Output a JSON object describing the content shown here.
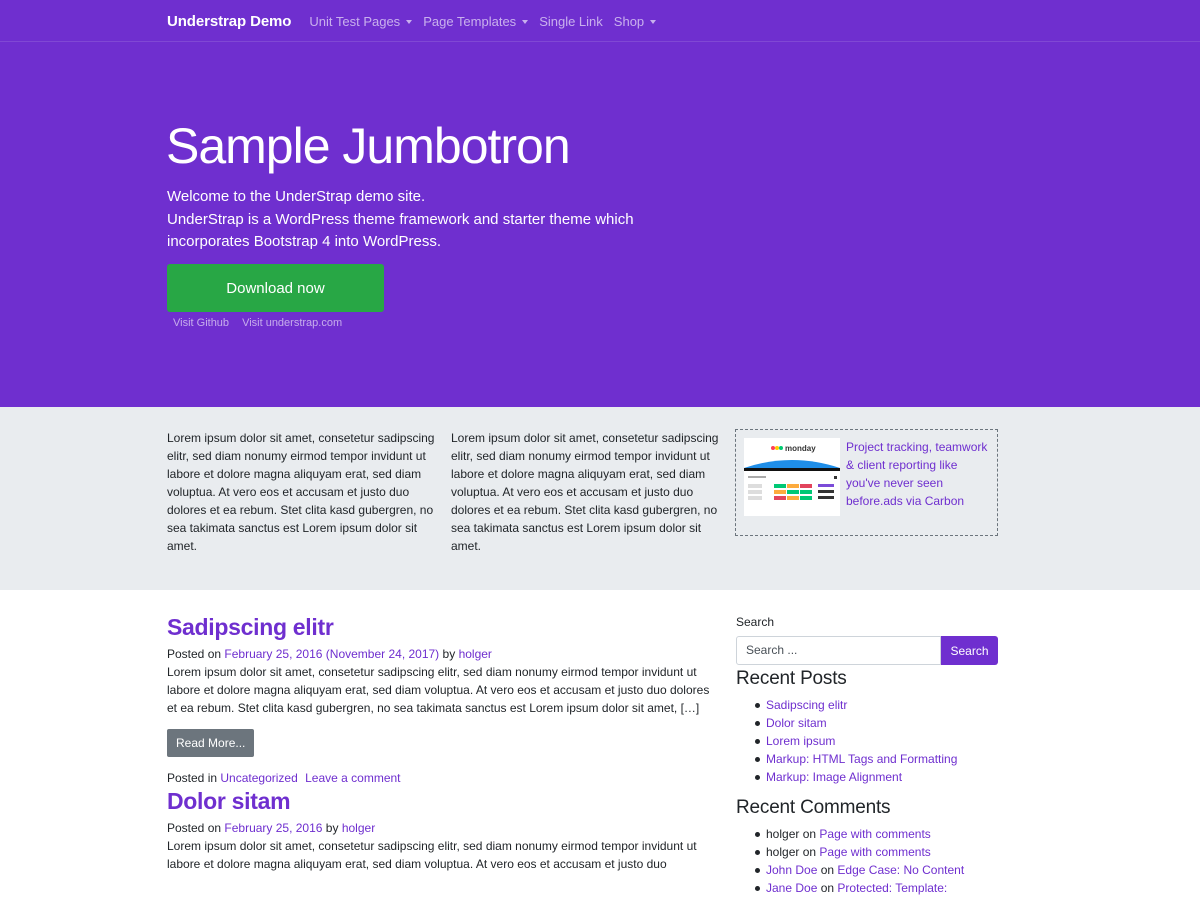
{
  "nav": {
    "brand": "Understrap Demo",
    "items": [
      {
        "label": "Unit Test Pages",
        "dropdown": true
      },
      {
        "label": "Page Templates",
        "dropdown": true
      },
      {
        "label": "Single Link",
        "dropdown": false
      },
      {
        "label": "Shop",
        "dropdown": true
      }
    ]
  },
  "hero": {
    "title": "Sample Jumbotron",
    "line1": "Welcome to the UnderStrap demo site.",
    "line2": "UnderStrap is a WordPress theme framework and starter theme which incorporates Bootstrap 4 into WordPress.",
    "button": "Download now",
    "link_github": "Visit Github",
    "link_site": "Visit understrap.com"
  },
  "band": {
    "col1": "Lorem ipsum dolor sit amet, consetetur sadipscing elitr, sed diam nonumy eirmod tempor invidunt ut labore et dolore magna aliquyam erat, sed diam voluptua. At vero eos et accusam et justo duo dolores et ea rebum. Stet clita kasd gubergren, no sea takimata sanctus est Lorem ipsum dolor sit amet.",
    "col2": "Lorem ipsum dolor sit amet, consetetur sadipscing elitr, sed diam nonumy eirmod tempor invidunt ut labore et dolore magna aliquyam erat, sed diam voluptua. At vero eos et accusam et justo duo dolores et ea rebum. Stet clita kasd gubergren, no sea takimata sanctus est Lorem ipsum dolor sit amet.",
    "ad_text": "Project tracking, teamwork & client reporting like you've never seen before.ads via Carbon",
    "ad_logo": "monday"
  },
  "posts": [
    {
      "title": "Sadipscing elitr",
      "posted_on_label": "Posted on",
      "date": "February 25, 2016 (November 24, 2017)",
      "by_label": "by",
      "author": "holger",
      "excerpt": "Lorem ipsum dolor sit amet, consetetur sadipscing elitr, sed diam nonumy eirmod tempor invidunt ut labore et dolore magna aliquyam erat, sed diam voluptua. At vero eos et accusam et justo duo dolores et ea rebum. Stet clita kasd gubergren, no sea takimata sanctus est Lorem ipsum dolor sit amet, […]",
      "read_more": "Read More...",
      "posted_in_label": "Posted in",
      "category": "Uncategorized",
      "comment_link": "Leave a comment"
    },
    {
      "title": "Dolor sitam",
      "posted_on_label": "Posted on",
      "date": "February 25, 2016",
      "by_label": "by",
      "author": "holger",
      "excerpt": "Lorem ipsum dolor sit amet, consetetur sadipscing elitr, sed diam nonumy eirmod tempor invidunt ut labore et dolore magna aliquyam erat, sed diam voluptua. At vero eos et accusam et justo duo"
    }
  ],
  "sidebar": {
    "search_label": "Search",
    "search_placeholder": "Search ...",
    "search_button": "Search",
    "recent_posts_title": "Recent Posts",
    "recent_posts": [
      "Sadipscing elitr",
      "Dolor sitam",
      "Lorem ipsum",
      "Markup: HTML Tags and Formatting",
      "Markup: Image Alignment"
    ],
    "recent_comments_title": "Recent Comments",
    "on_label": "on",
    "recent_comments": [
      {
        "author": "holger",
        "author_link": false,
        "post": "Page with comments"
      },
      {
        "author": "holger",
        "author_link": false,
        "post": "Page with comments"
      },
      {
        "author": "John Doe",
        "author_link": true,
        "post": "Edge Case: No Content"
      },
      {
        "author": "Jane Doe",
        "author_link": true,
        "post": "Protected: Template:"
      }
    ]
  },
  "colors": {
    "primary": "#6f2fcf",
    "success": "#28a745",
    "secondary": "#6c757d",
    "band": "#e9ecef"
  }
}
